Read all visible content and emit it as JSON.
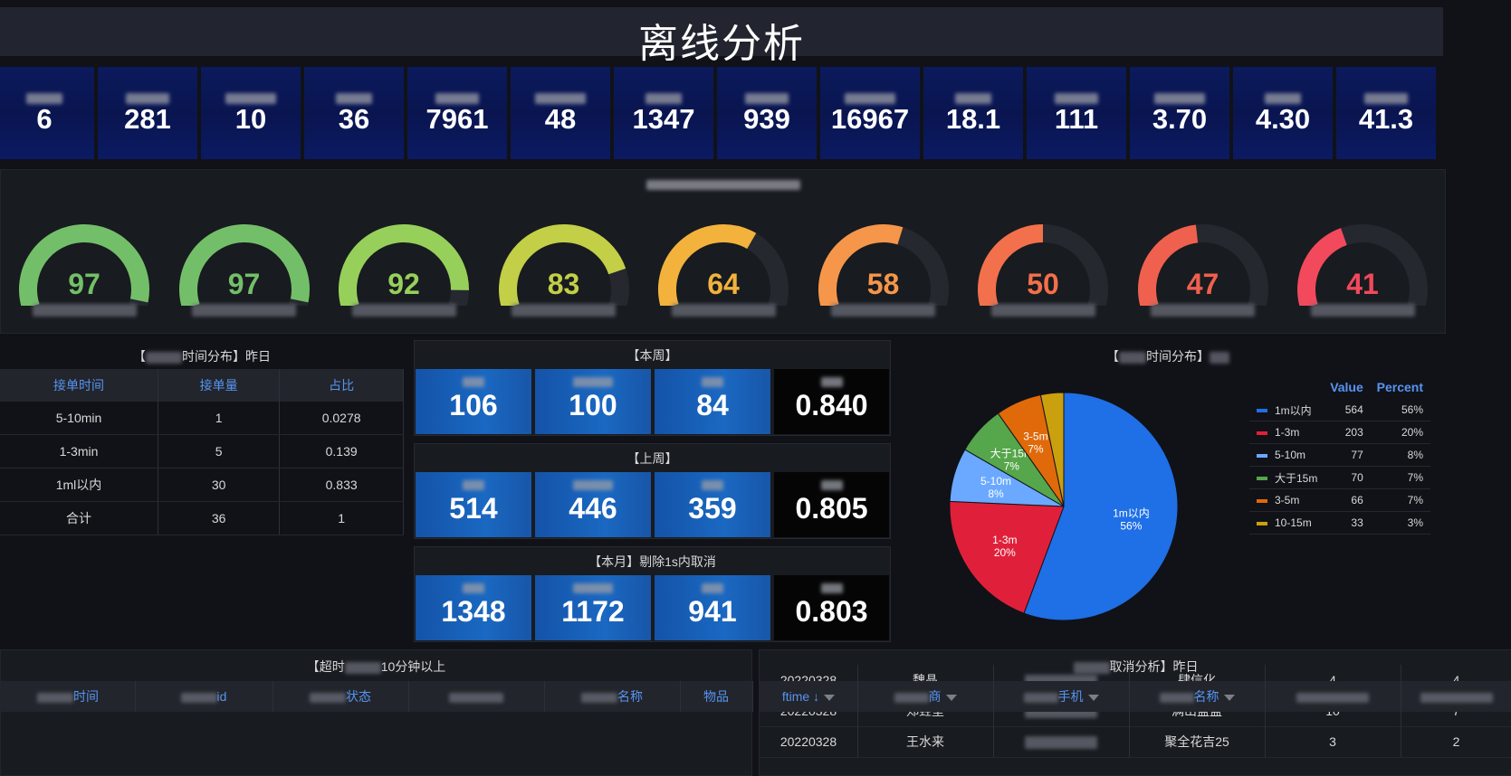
{
  "title": "离线分析",
  "stats": [
    "6",
    "281",
    "10",
    "36",
    "7961",
    "48",
    "1347",
    "939",
    "16967",
    "18.1",
    "111",
    "3.70",
    "4.30",
    "41.3"
  ],
  "gauges": [
    {
      "value": "97",
      "color": "#73bf69",
      "level": 97
    },
    {
      "value": "97",
      "color": "#73bf69",
      "level": 97
    },
    {
      "value": "92",
      "color": "#96d05b",
      "level": 92
    },
    {
      "value": "83",
      "color": "#c2cf47",
      "level": 83
    },
    {
      "value": "64",
      "color": "#f2b23c",
      "level": 64
    },
    {
      "value": "58",
      "color": "#f5964a",
      "level": 58
    },
    {
      "value": "50",
      "color": "#f2704b",
      "level": 50
    },
    {
      "value": "47",
      "color": "#f0604e",
      "level": 47
    },
    {
      "value": "41",
      "color": "#f2495c",
      "level": 41
    }
  ],
  "left_table": {
    "title_suffix": "时间分布】昨日",
    "headers": [
      "接单时间",
      "接单量",
      "占比"
    ],
    "rows": [
      [
        "5-10min",
        "1",
        "0.0278"
      ],
      [
        "1-3min",
        "5",
        "0.139"
      ],
      [
        "1ml以内",
        "30",
        "0.833"
      ],
      [
        "合计",
        "36",
        "1"
      ]
    ]
  },
  "mid": [
    {
      "title": "【本周】",
      "values": [
        "106",
        "100",
        "84",
        "0.840"
      ]
    },
    {
      "title": "【上周】",
      "values": [
        "514",
        "446",
        "359",
        "0.805"
      ]
    },
    {
      "title": "【本月】剔除1s内取消",
      "values": [
        "1348",
        "1172",
        "941",
        "0.803"
      ]
    }
  ],
  "pie": {
    "title_suffix": "时间分布】",
    "legend_headers": [
      "Value",
      "Percent"
    ],
    "slices": [
      {
        "name": "1m以内",
        "value": 564,
        "percent": "56%",
        "color": "#1f6fe6",
        "label": "1m以内",
        "label_pct": "56%"
      },
      {
        "name": "1-3m",
        "value": 203,
        "percent": "20%",
        "color": "#e0203a",
        "label": "1-3m",
        "label_pct": "20%"
      },
      {
        "name": "5-10m",
        "value": 77,
        "percent": "8%",
        "color": "#6aa9ff",
        "label": "5-10m",
        "label_pct": "8%"
      },
      {
        "name": "大于15m",
        "value": 70,
        "percent": "7%",
        "color": "#56a64b",
        "label": "大于15m",
        "label_pct": "7%"
      },
      {
        "name": "3-5m",
        "value": 66,
        "percent": "7%",
        "color": "#e0690a",
        "label": "3-5m",
        "label_pct": "7%"
      },
      {
        "name": "10-15m",
        "value": 33,
        "percent": "3%",
        "color": "#caa00f",
        "label": "",
        "label_pct": ""
      }
    ]
  },
  "bottom_left": {
    "title_prefix": "【超时",
    "title_suffix": "10分钟以上",
    "headers": [
      "时间",
      "id",
      "状态",
      "",
      "名称",
      "物品"
    ]
  },
  "bottom_right": {
    "title_suffix": "取消分析】昨日",
    "headers": [
      "ftime ↓",
      "商",
      "手机",
      "名称",
      "",
      ""
    ],
    "rows": [
      [
        "20220328",
        "魏晶",
        "",
        "肆信化",
        "4",
        "4"
      ],
      [
        "20220328",
        "郑垚堃",
        "",
        "满山盘盘",
        "10",
        "7"
      ],
      [
        "20220328",
        "王水来",
        "",
        "聚全花吉25",
        "3",
        "2"
      ]
    ]
  }
}
